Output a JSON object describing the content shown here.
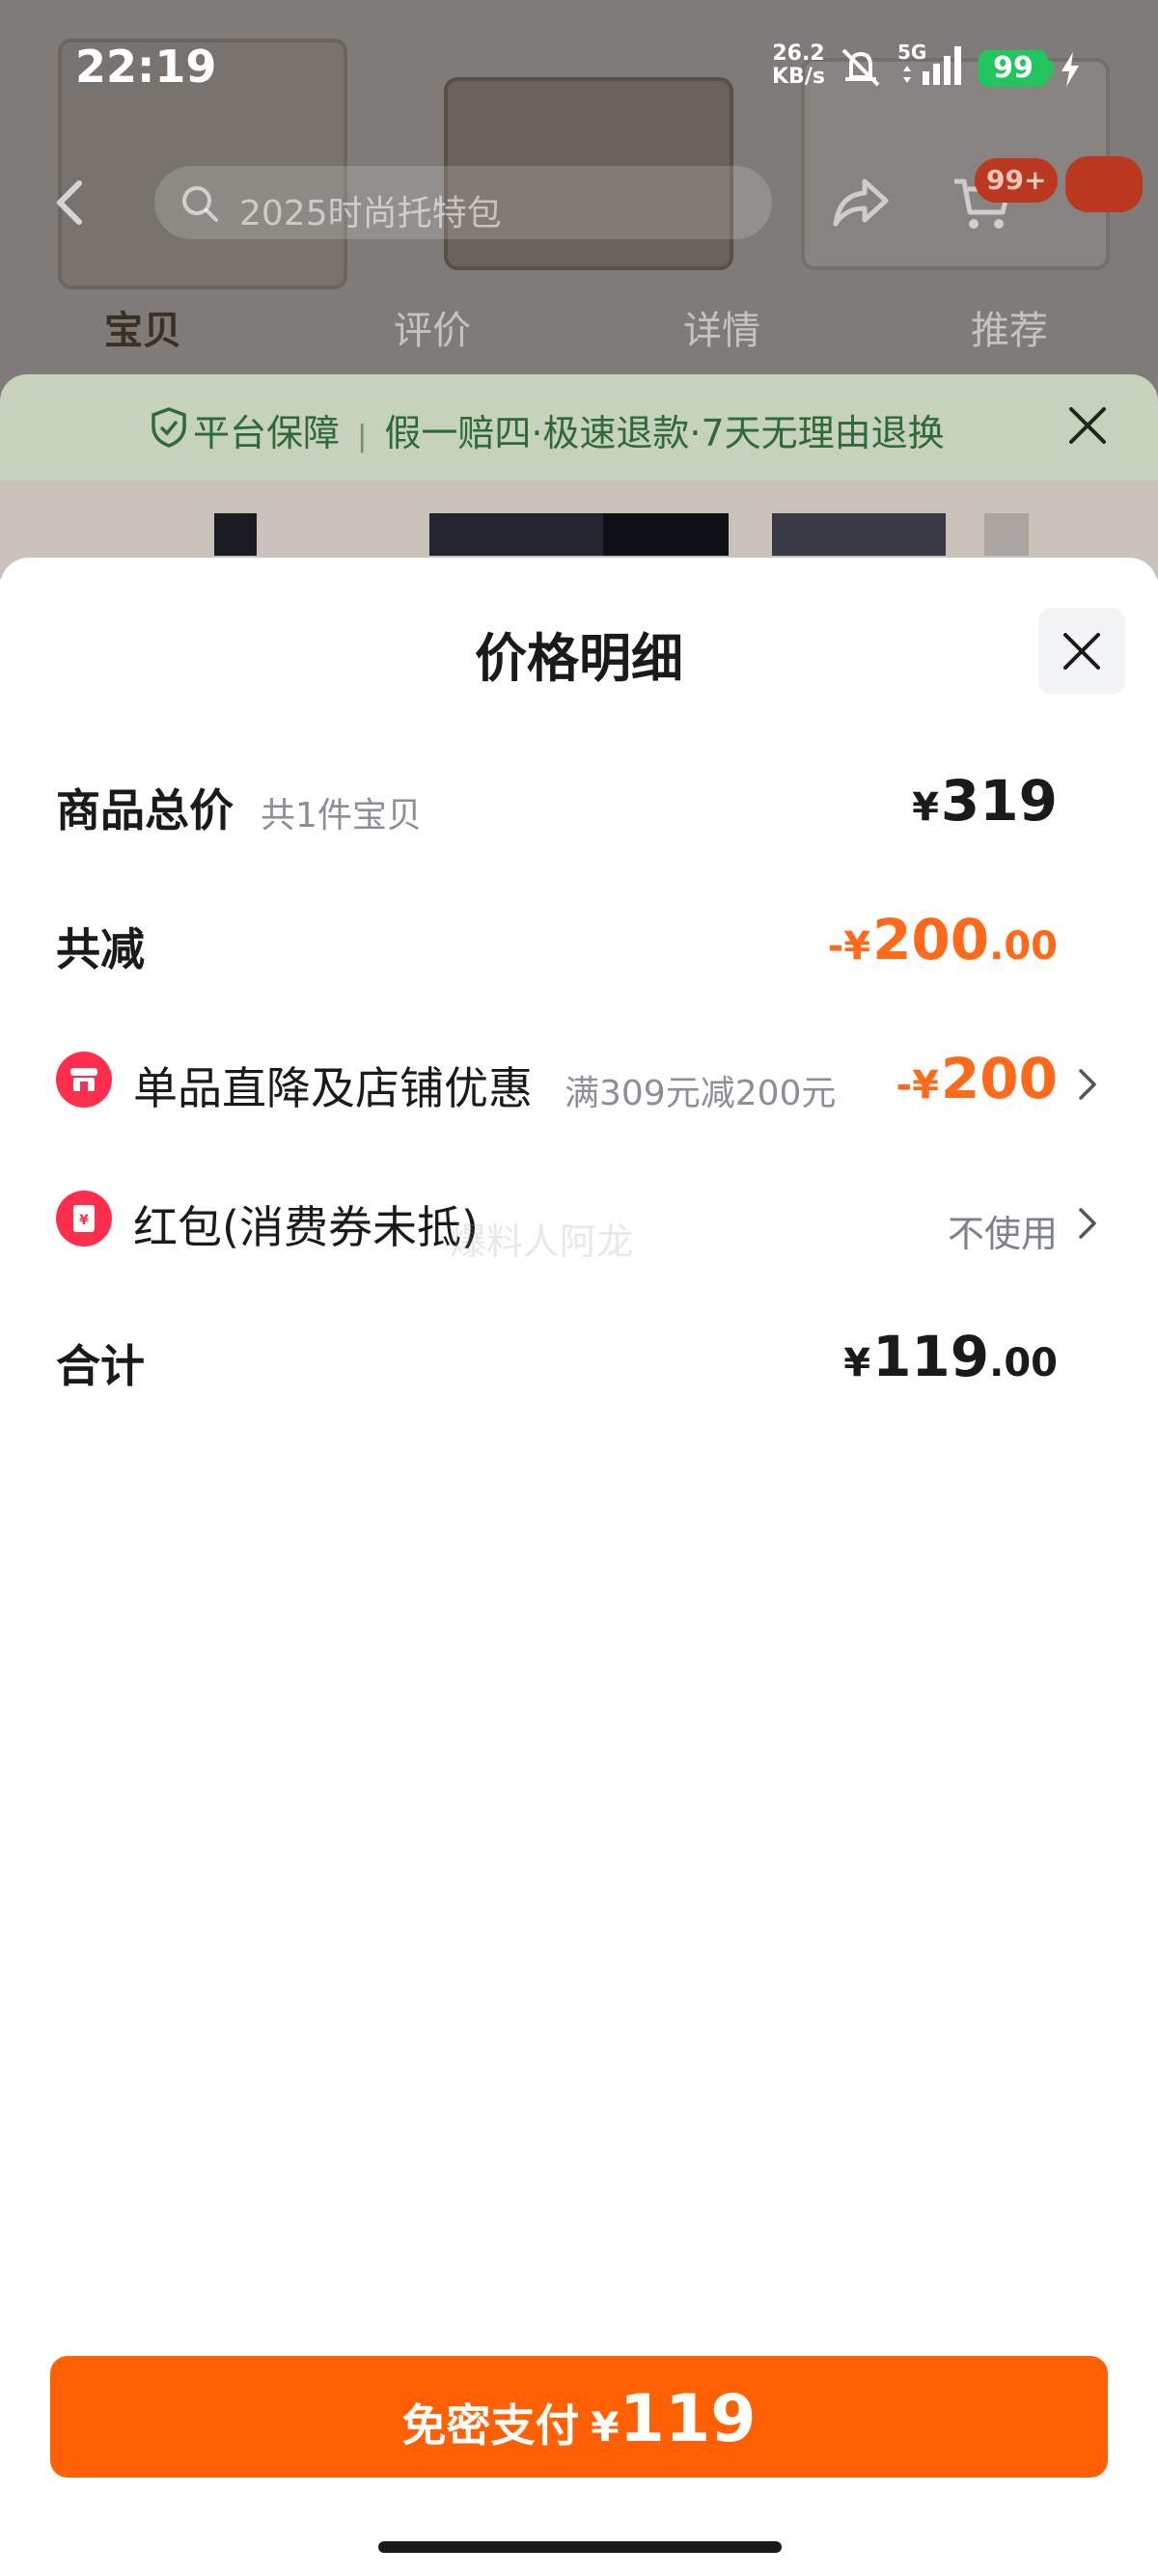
{
  "status_bar": {
    "time": "22:19",
    "net_speed_value": "26.2",
    "net_speed_unit": "KB/s",
    "network_type": "5G",
    "battery": "99"
  },
  "header": {
    "search_placeholder": "2025时尚托特包",
    "cart_badge": "99+"
  },
  "tabs": [
    {
      "label": "宝贝",
      "active": true
    },
    {
      "label": "评价",
      "active": false
    },
    {
      "label": "详情",
      "active": false
    },
    {
      "label": "推荐",
      "active": false
    }
  ],
  "guarantee": {
    "title": "平台保障",
    "text": "假一赔四·极速退款·7天无理由退换"
  },
  "sheet": {
    "title": "价格明细",
    "watermark": "爆料人阿龙",
    "rows": {
      "total": {
        "label": "商品总价",
        "sub": "共1件宝贝",
        "currency": "¥",
        "amount": "319"
      },
      "discount": {
        "label": "共减",
        "prefix": "-¥",
        "amount": "200",
        "decimal": ".00"
      },
      "store_discount": {
        "label": "单品直降及店铺优惠",
        "sub": "满309元减200元",
        "prefix": "-¥",
        "amount": "200"
      },
      "red_packet": {
        "label": "红包(消费券未抵)",
        "value": "不使用"
      },
      "sum": {
        "label": "合计",
        "currency": "¥",
        "amount": "119",
        "decimal": ".00"
      }
    },
    "pay_button": {
      "label": "免密支付",
      "currency": "¥",
      "amount": "119"
    }
  },
  "colors": {
    "accent": "#ff6004",
    "discount_text": "#ff6a1a",
    "icon_red": "#ff2e4d"
  }
}
